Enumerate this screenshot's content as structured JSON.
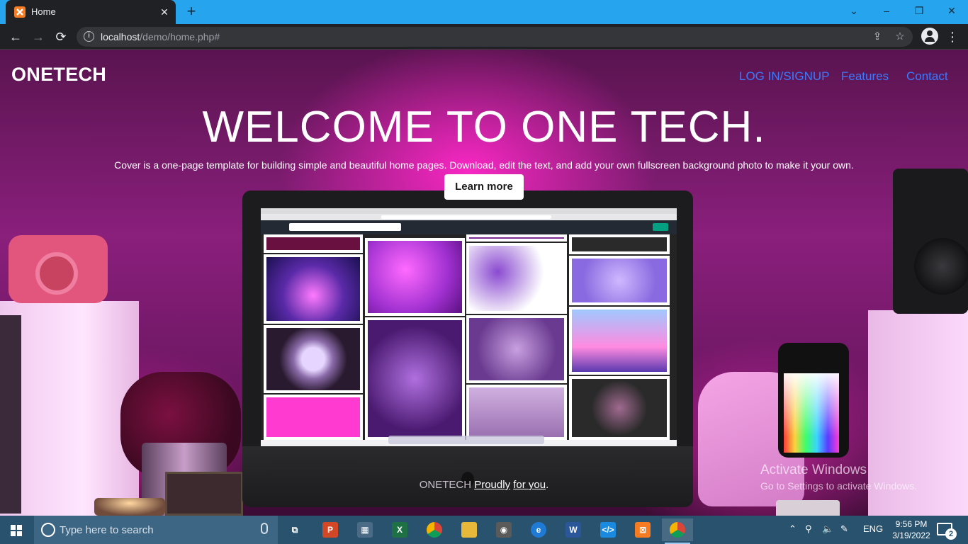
{
  "browser": {
    "tab": {
      "title": "Home",
      "close": "✕"
    },
    "new_tab": "+",
    "window_controls": {
      "chevron": "⌄",
      "minimize": "–",
      "restore": "❐",
      "close": "✕"
    },
    "nav": {
      "back": "←",
      "forward": "→",
      "reload": "⟳"
    },
    "address": {
      "host": "localhost",
      "path": "/demo/home.php#"
    },
    "icons": [
      "site-info-icon",
      "share-icon",
      "bookmark-star-icon",
      "profile-icon",
      "menu-icon"
    ]
  },
  "page": {
    "brand": "ONETECH",
    "nav_links": [
      "LOG IN/SIGNUP",
      "Features",
      "Contact"
    ],
    "hero": {
      "title": "WELCOME TO ONE TECH.",
      "lead": "Cover is a one-page template for building simple and beautiful home pages. Download, edit the text, and add your own fullscreen background photo to make it your own.",
      "cta": "Learn more"
    },
    "footer": {
      "brand": "ONETECH",
      "link1": "Proudly",
      "link2": "for you",
      "end": "."
    },
    "colors": {
      "nav_link": "#3a7bff",
      "hero_glow": "#ff28c8"
    }
  },
  "windows": {
    "activate_title": "Activate Windows",
    "activate_sub": "Go to Settings to activate Windows."
  },
  "taskbar": {
    "search_placeholder": "Type here to search",
    "apps": [
      {
        "name": "task-view",
        "label": "⧉",
        "color": "transparent"
      },
      {
        "name": "powerpoint",
        "label": "P",
        "color": "#d24726"
      },
      {
        "name": "store",
        "label": "▦",
        "color": "#4a6a86"
      },
      {
        "name": "excel",
        "label": "X",
        "color": "#1e7145"
      },
      {
        "name": "chrome",
        "label": "●",
        "color": "#e3b42b"
      },
      {
        "name": "file-explorer",
        "label": "▭",
        "color": "#e8b83a"
      },
      {
        "name": "camera",
        "label": "◉",
        "color": "#5a5a5a"
      },
      {
        "name": "edge",
        "label": "e",
        "color": "#1f7ad6"
      },
      {
        "name": "word",
        "label": "W",
        "color": "#2b579a"
      },
      {
        "name": "vscode",
        "label": "⟨⟩",
        "color": "#1a8ae0"
      },
      {
        "name": "xampp",
        "label": "⊠",
        "color": "#f57c22"
      },
      {
        "name": "chrome-active",
        "label": "●",
        "color": "#e3b42b"
      }
    ],
    "tray": {
      "chevron": "⌃",
      "lang": "ENG"
    },
    "clock": {
      "time": "9:56 PM",
      "date": "3/19/2022"
    },
    "notifications": "2"
  }
}
